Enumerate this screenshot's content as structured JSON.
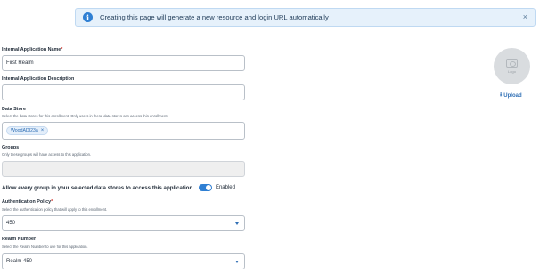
{
  "banner": {
    "message": "Creating this page will generate a new resource and login URL automatically",
    "info_icon": "i",
    "close_icon": "×"
  },
  "form": {
    "app_name": {
      "label": "Internal Application Name",
      "required_mark": "*",
      "value": "First Realm"
    },
    "app_description": {
      "label": "Internal Application Description",
      "value": ""
    },
    "data_store": {
      "label": "Data Store",
      "help": "Select the data stores for this enrollment. Only users in these data stores can access this enrollment.",
      "chip_label": "WoodADI23a",
      "chip_remove": "×"
    },
    "groups": {
      "label": "Groups",
      "help": "Only these groups will have access to this application.",
      "value": ""
    },
    "allow_every_group": {
      "label": "Allow every group in your selected data stores to access this application.",
      "state": "Enabled",
      "on": true
    },
    "auth_policy": {
      "label": "Authentication Policy",
      "required_mark": "*",
      "help": "Select the authentication policy that will apply to this enrollment.",
      "value": "450"
    },
    "realm_number": {
      "label": "Realm Number",
      "help": "Select the Realm Number to use for this application.",
      "value": "Realm 450"
    }
  },
  "logo": {
    "placeholder_text": "Logo",
    "upload_label": "Upload",
    "upload_icon": "⭳"
  },
  "colors": {
    "accent": "#2f7fd3",
    "banner_bg": "#e6f1fb",
    "required": "#d0342c"
  }
}
